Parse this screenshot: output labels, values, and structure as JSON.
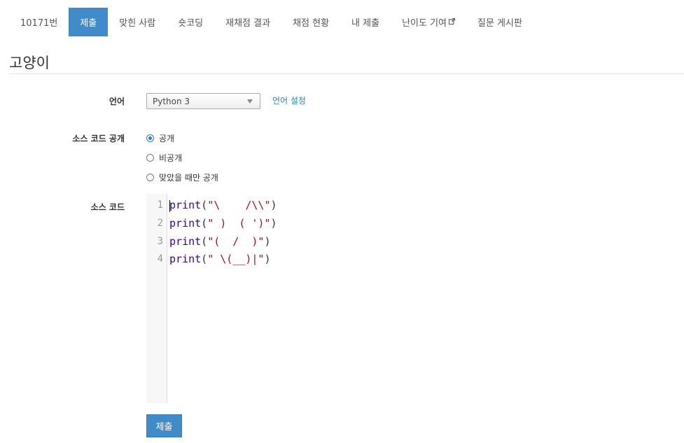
{
  "nav": {
    "items": [
      {
        "label": "10171번"
      },
      {
        "label": "제출"
      },
      {
        "label": "맞힌 사람"
      },
      {
        "label": "숏코딩"
      },
      {
        "label": "재채점 결과"
      },
      {
        "label": "채점 현황"
      },
      {
        "label": "내 제출"
      },
      {
        "label": "난이도 기여"
      },
      {
        "label": "질문 게시판"
      }
    ],
    "active_index": 1,
    "external_icon": "external-link-icon"
  },
  "page": {
    "title": "고양이"
  },
  "form": {
    "language": {
      "label": "언어",
      "selected": "Python 3",
      "settings_link": "언어 설정"
    },
    "visibility": {
      "label": "소스 코드 공개",
      "options": [
        {
          "label": "공개",
          "checked": true
        },
        {
          "label": "비공개",
          "checked": false
        },
        {
          "label": "맞았을 때만 공개",
          "checked": false
        }
      ]
    },
    "source": {
      "label": "소스 코드",
      "lines": [
        {
          "num": "1",
          "fn": "print",
          "open": "(",
          "str": "\"\\    /\\\\\"",
          "close": ")"
        },
        {
          "num": "2",
          "fn": "print",
          "open": "(",
          "str": "\" )  ( ')\"",
          "close": ")"
        },
        {
          "num": "3",
          "fn": "print",
          "open": "(",
          "str": "\"(  /  )\"",
          "close": ")"
        },
        {
          "num": "4",
          "fn": "print",
          "open": "(",
          "str": "\" \\(__)|\"",
          "close": ")"
        }
      ]
    },
    "submit_label": "제출"
  },
  "colors": {
    "accent": "#428bca",
    "link": "#2a7fc1",
    "keyword": "#3300aa",
    "string": "#aa1111"
  }
}
